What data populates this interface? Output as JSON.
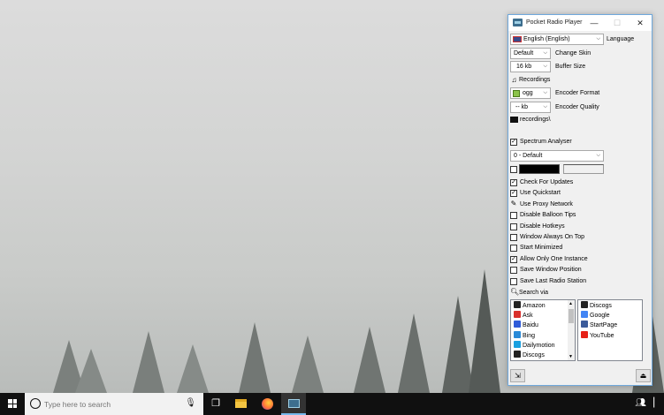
{
  "window": {
    "title": "Pocket Radio Player",
    "minimize": "—",
    "maximize": "☐",
    "close": "✕"
  },
  "settings": {
    "language_value": "English (English)",
    "language_label": "Language",
    "skin_value": "Default",
    "skin_label": "Change Skin",
    "buffer_value": "16 kb",
    "buffer_label": "Buffer Size",
    "recordings_label": "Recordings",
    "encoder_format_value": "ogg",
    "encoder_format_label": "Encoder Format",
    "encoder_quality_value": "-- kb",
    "encoder_quality_label": "Encoder Quality",
    "recordings_path": "recordings\\",
    "spectrum_label": "Spectrum Analyser",
    "spectrum_value": "0 - Default",
    "color_value": "#000000"
  },
  "options": [
    {
      "label": "Check For Updates",
      "checked": true
    },
    {
      "label": "Use Quickstart",
      "checked": true
    },
    {
      "label": "Use Proxy Network",
      "checked": false
    },
    {
      "label": "Disable Balloon Tips",
      "checked": false
    },
    {
      "label": "Disable Hotkeys",
      "checked": false
    },
    {
      "label": "Window Always On Top",
      "checked": false
    },
    {
      "label": "Start Minimized",
      "checked": false
    },
    {
      "label": "Allow Only One Instance",
      "checked": true
    },
    {
      "label": "Save Window Position",
      "checked": false
    },
    {
      "label": "Save Last Radio Station",
      "checked": false
    }
  ],
  "search": {
    "label": "Search via",
    "left_list": [
      {
        "label": "Amazon",
        "color": "#222222"
      },
      {
        "label": "Ask",
        "color": "#d9302c"
      },
      {
        "label": "Baidu",
        "color": "#2f5bd9"
      },
      {
        "label": "Bing",
        "color": "#2a8ad8"
      },
      {
        "label": "Dailymotion",
        "color": "#1aa0e0"
      },
      {
        "label": "Discogs",
        "color": "#222222"
      }
    ],
    "right_list": [
      {
        "label": "Discogs",
        "color": "#222222"
      },
      {
        "label": "Google",
        "color": "#4285f4"
      },
      {
        "label": "StartPage",
        "color": "#3b5b9a"
      },
      {
        "label": "YouTube",
        "color": "#e62117"
      }
    ]
  },
  "taskbar": {
    "search_placeholder": "Type here to search"
  }
}
